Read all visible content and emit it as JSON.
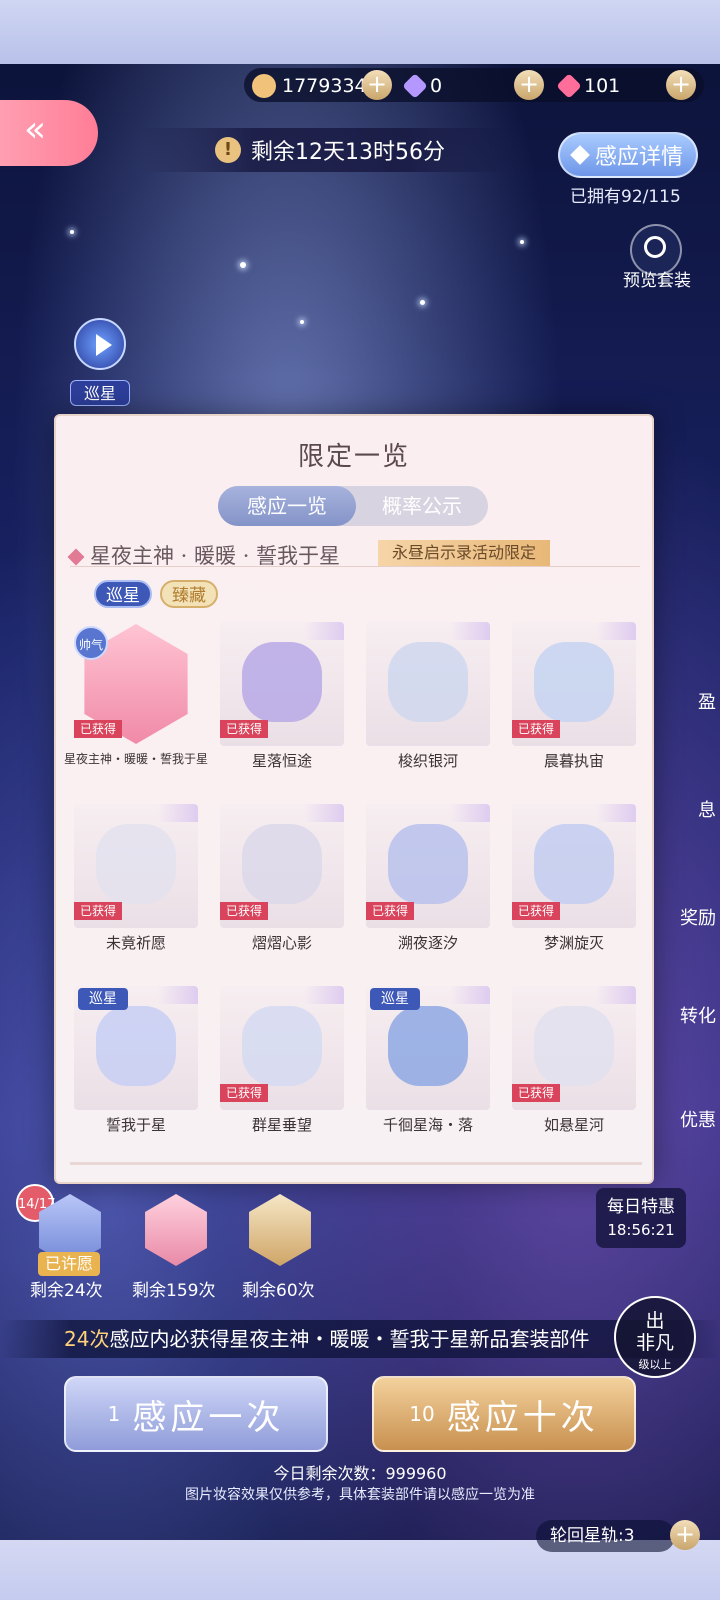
{
  "currency": {
    "gold": "1779334",
    "purple_gem": "0",
    "pink_gem": "101"
  },
  "header": {
    "countdown": "剩余12天13时56分",
    "detail_button": "感应详情",
    "owned": "已拥有92/115",
    "preview_label": "预览套装",
    "patrol_label": "巡星"
  },
  "side_menu": [
    "盈",
    "息",
    "奖励",
    "转化",
    "优惠"
  ],
  "modal": {
    "title": "限定一览",
    "tabs": [
      "感应一览",
      "概率公示"
    ],
    "suit_name": "星夜主神 · 暖暖 · 誓我于星",
    "limited_tag": "永昼启示录活动限定",
    "badge_patrol": "巡星",
    "badge_treasure": "臻藏",
    "obtained_label": "已获得",
    "cool_label": "帅气",
    "items": [
      {
        "name": "星夜主神・暖暖・誓我于星",
        "obtained": true,
        "patrol": false,
        "color": "#f4a3bd"
      },
      {
        "name": "星落恒途",
        "obtained": true,
        "patrol": false,
        "color": "#b7a9e6"
      },
      {
        "name": "梭织银河",
        "obtained": false,
        "patrol": false,
        "color": "#cfd7ef"
      },
      {
        "name": "晨暮执宙",
        "obtained": true,
        "patrol": false,
        "color": "#c5d3f1"
      },
      {
        "name": "未竟祈愿",
        "obtained": true,
        "patrol": false,
        "color": "#e3e2ee"
      },
      {
        "name": "熠熠心影",
        "obtained": true,
        "patrol": false,
        "color": "#dcd8ea"
      },
      {
        "name": "溯夜逐汐",
        "obtained": true,
        "patrol": false,
        "color": "#b9c2ec"
      },
      {
        "name": "梦渊旋灭",
        "obtained": true,
        "patrol": false,
        "color": "#c3cdf0"
      },
      {
        "name": "誓我于星",
        "obtained": false,
        "patrol": true,
        "color": "#c7cff5"
      },
      {
        "name": "群星垂望",
        "obtained": true,
        "patrol": false,
        "color": "#d5dbf1"
      },
      {
        "name": "千徊星海・落",
        "obtained": false,
        "patrol": true,
        "color": "#8ea8e4"
      },
      {
        "name": "如悬星河",
        "obtained": true,
        "patrol": false,
        "color": "#e2e0ee"
      }
    ]
  },
  "rewards": {
    "progress": "14/17",
    "wished": "已许愿",
    "remain": [
      "剩余24次",
      "剩余159次",
      "剩余60次"
    ]
  },
  "daily": {
    "title": "每日特惠",
    "time": "18:56:21"
  },
  "guarantee": {
    "count": "24次",
    "text": "感应内必获得星夜主神・暖暖・誓我于星新品套装部件"
  },
  "special_badge": {
    "line1": "出",
    "line2": "非凡",
    "sub": "级以上"
  },
  "pull": {
    "one_count": "1",
    "one_label": "感应一次",
    "ten_count": "10",
    "ten_label": "感应十次"
  },
  "today_remain": "今日剩余次数：999960",
  "disclaimer": "图片妆容效果仅供参考，具体套装部件请以感应一览为准",
  "cycle": "轮回星轨:3"
}
